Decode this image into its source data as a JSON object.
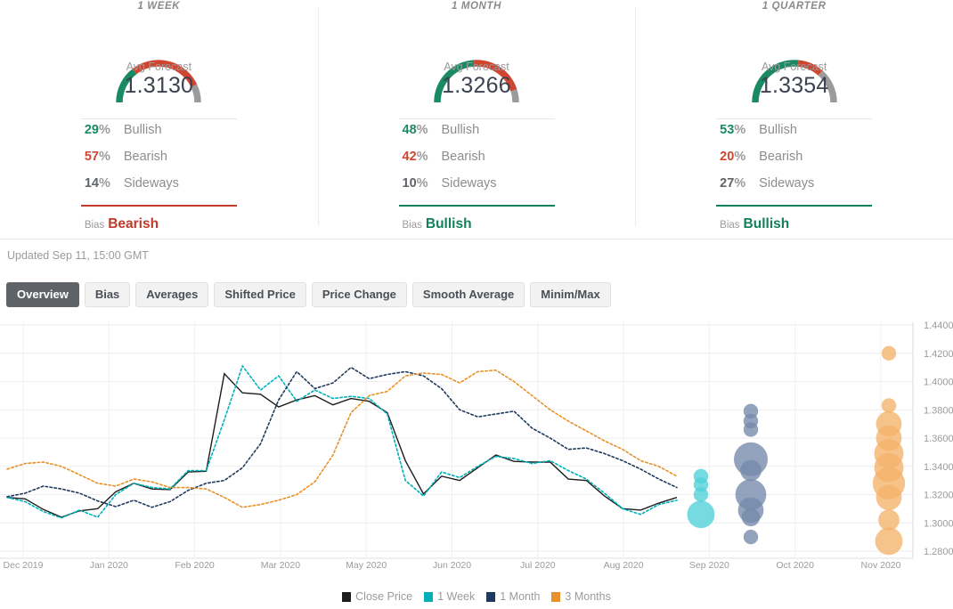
{
  "panels": [
    {
      "title": "1 WEEK",
      "forecast_label": "Avg Forecast",
      "forecast_value": "1.3130",
      "gauge": {
        "bullish": 29,
        "bearish": 57,
        "sideways": 14
      },
      "rows": [
        {
          "pct": "29",
          "sym": "%",
          "label": "Bullish",
          "color": "#1a8a62"
        },
        {
          "pct": "57",
          "sym": "%",
          "label": "Bearish",
          "color": "#cf4530"
        },
        {
          "pct": "14",
          "sym": "%",
          "label": "Sideways",
          "color": "#5f6368"
        }
      ],
      "bias_word": "Bias",
      "bias_value": "Bearish",
      "bias_color": "#c0392b"
    },
    {
      "title": "1 MONTH",
      "forecast_label": "Avg Forecast",
      "forecast_value": "1.3266",
      "gauge": {
        "bullish": 48,
        "bearish": 42,
        "sideways": 10
      },
      "rows": [
        {
          "pct": "48",
          "sym": "%",
          "label": "Bullish",
          "color": "#1a8a62"
        },
        {
          "pct": "42",
          "sym": "%",
          "label": "Bearish",
          "color": "#cf4530"
        },
        {
          "pct": "10",
          "sym": "%",
          "label": "Sideways",
          "color": "#5f6368"
        }
      ],
      "bias_word": "Bias",
      "bias_value": "Bullish",
      "bias_color": "#12805a"
    },
    {
      "title": "1 QUARTER",
      "forecast_label": "Avg Forecast",
      "forecast_value": "1.3354",
      "gauge": {
        "bullish": 53,
        "bearish": 20,
        "sideways": 27
      },
      "rows": [
        {
          "pct": "53",
          "sym": "%",
          "label": "Bullish",
          "color": "#1a8a62"
        },
        {
          "pct": "20",
          "sym": "%",
          "label": "Bearish",
          "color": "#cf4530"
        },
        {
          "pct": "27",
          "sym": "%",
          "label": "Sideways",
          "color": "#5f6368"
        }
      ],
      "bias_word": "Bias",
      "bias_value": "Bullish",
      "bias_color": "#12805a"
    }
  ],
  "updated": "Updated Sep 11, 15:00 GMT",
  "tabs": [
    {
      "label": "Overview",
      "active": true
    },
    {
      "label": "Bias",
      "active": false
    },
    {
      "label": "Averages",
      "active": false
    },
    {
      "label": "Shifted Price",
      "active": false
    },
    {
      "label": "Price Change",
      "active": false
    },
    {
      "label": "Smooth Average",
      "active": false
    },
    {
      "label": "Minim/Max",
      "active": false
    }
  ],
  "colors": {
    "close_price": "#1d1d1d",
    "one_week": "#00b0b9",
    "one_month": "#1f3a5f",
    "three_months": "#e8912a",
    "bullish": "#1a8a62",
    "bearish": "#cf4530",
    "sideways": "#9b9b9b"
  },
  "chart_data": {
    "type": "line",
    "title": "",
    "xlabel": "",
    "ylabel": "",
    "ylim": [
      1.28,
      1.44
    ],
    "yticks": [
      "1.2800",
      "1.3000",
      "1.3200",
      "1.3400",
      "1.3600",
      "1.3800",
      "1.4000",
      "1.4200",
      "1.4400"
    ],
    "xticks": [
      "Dec 2019",
      "Jan 2020",
      "Feb 2020",
      "Mar 2020",
      "May 2020",
      "Jun 2020",
      "Jul 2020",
      "Aug 2020",
      "Sep 2020",
      "Oct 2020",
      "Nov 2020"
    ],
    "grid": true,
    "legend_position": "bottom",
    "series": [
      {
        "name": "Close Price",
        "color": "#1d1d1d",
        "style": "solid",
        "values": [
          1.318,
          1.317,
          1.3095,
          1.304,
          1.3085,
          1.31,
          1.322,
          1.328,
          1.324,
          1.3235,
          1.336,
          1.3365,
          1.4055,
          1.392,
          1.391,
          1.382,
          1.387,
          1.39,
          1.3835,
          1.388,
          1.386,
          1.378,
          1.344,
          1.3205,
          1.333,
          1.33,
          1.339,
          1.348,
          1.3435,
          1.343,
          1.343,
          1.331,
          1.33,
          1.319,
          1.31,
          1.309,
          1.314,
          1.318
        ]
      },
      {
        "name": "1 Week",
        "color": "#00b0b9",
        "style": "dotted",
        "values": [
          1.318,
          1.315,
          1.308,
          1.3035,
          1.309,
          1.304,
          1.32,
          1.328,
          1.325,
          1.324,
          1.337,
          1.337,
          1.373,
          1.411,
          1.394,
          1.404,
          1.386,
          1.394,
          1.388,
          1.3895,
          1.388,
          1.377,
          1.33,
          1.319,
          1.336,
          1.332,
          1.34,
          1.347,
          1.3455,
          1.342,
          1.344,
          1.337,
          1.331,
          1.321,
          1.31,
          1.306,
          1.313,
          1.316
        ]
      },
      {
        "name": "1 Month",
        "color": "#1f3a5f",
        "style": "dotted",
        "values": [
          1.3185,
          1.321,
          1.326,
          1.324,
          1.321,
          1.3155,
          1.3115,
          1.316,
          1.311,
          1.315,
          1.323,
          1.328,
          1.33,
          1.339,
          1.356,
          1.387,
          1.407,
          1.395,
          1.399,
          1.41,
          1.402,
          1.405,
          1.407,
          1.404,
          1.395,
          1.38,
          1.375,
          1.377,
          1.379,
          1.367,
          1.36,
          1.352,
          1.353,
          1.349,
          1.344,
          1.338,
          1.331,
          1.325
        ]
      },
      {
        "name": "3 Months",
        "color": "#e8912a",
        "style": "dotted",
        "values": [
          1.338,
          1.342,
          1.343,
          1.34,
          1.334,
          1.328,
          1.326,
          1.331,
          1.329,
          1.325,
          1.325,
          1.324,
          1.318,
          1.311,
          1.313,
          1.316,
          1.32,
          1.329,
          1.348,
          1.378,
          1.39,
          1.393,
          1.404,
          1.406,
          1.405,
          1.399,
          1.407,
          1.408,
          1.4,
          1.39,
          1.38,
          1.372,
          1.365,
          1.358,
          1.352,
          1.344,
          1.34,
          1.333
        ]
      }
    ],
    "forecast_clusters": [
      {
        "name": "1 Week",
        "color": "#4fd0d8",
        "x_label": "Sep 2020",
        "points": [
          {
            "value": 1.333,
            "weight": 1
          },
          {
            "value": 1.327,
            "weight": 1
          },
          {
            "value": 1.32,
            "weight": 1
          },
          {
            "value": 1.306,
            "weight": 6
          }
        ]
      },
      {
        "name": "1 Month",
        "color": "#7489ab",
        "x_label": "between Sep and Oct 2020",
        "points": [
          {
            "value": 1.379,
            "weight": 1
          },
          {
            "value": 1.372,
            "weight": 1
          },
          {
            "value": 1.366,
            "weight": 1
          },
          {
            "value": 1.345,
            "weight": 10
          },
          {
            "value": 1.337,
            "weight": 3
          },
          {
            "value": 1.32,
            "weight": 8
          },
          {
            "value": 1.309,
            "weight": 5
          },
          {
            "value": 1.304,
            "weight": 2
          },
          {
            "value": 1.29,
            "weight": 1
          }
        ]
      },
      {
        "name": "3 Months",
        "color": "#f4b26a",
        "x_label": "Nov 2020",
        "points": [
          {
            "value": 1.42,
            "weight": 1
          },
          {
            "value": 1.383,
            "weight": 1
          },
          {
            "value": 1.37,
            "weight": 5
          },
          {
            "value": 1.36,
            "weight": 5
          },
          {
            "value": 1.349,
            "weight": 7
          },
          {
            "value": 1.339,
            "weight": 7
          },
          {
            "value": 1.328,
            "weight": 9
          },
          {
            "value": 1.318,
            "weight": 5
          },
          {
            "value": 1.302,
            "weight": 3
          },
          {
            "value": 1.287,
            "weight": 6
          }
        ]
      }
    ]
  }
}
